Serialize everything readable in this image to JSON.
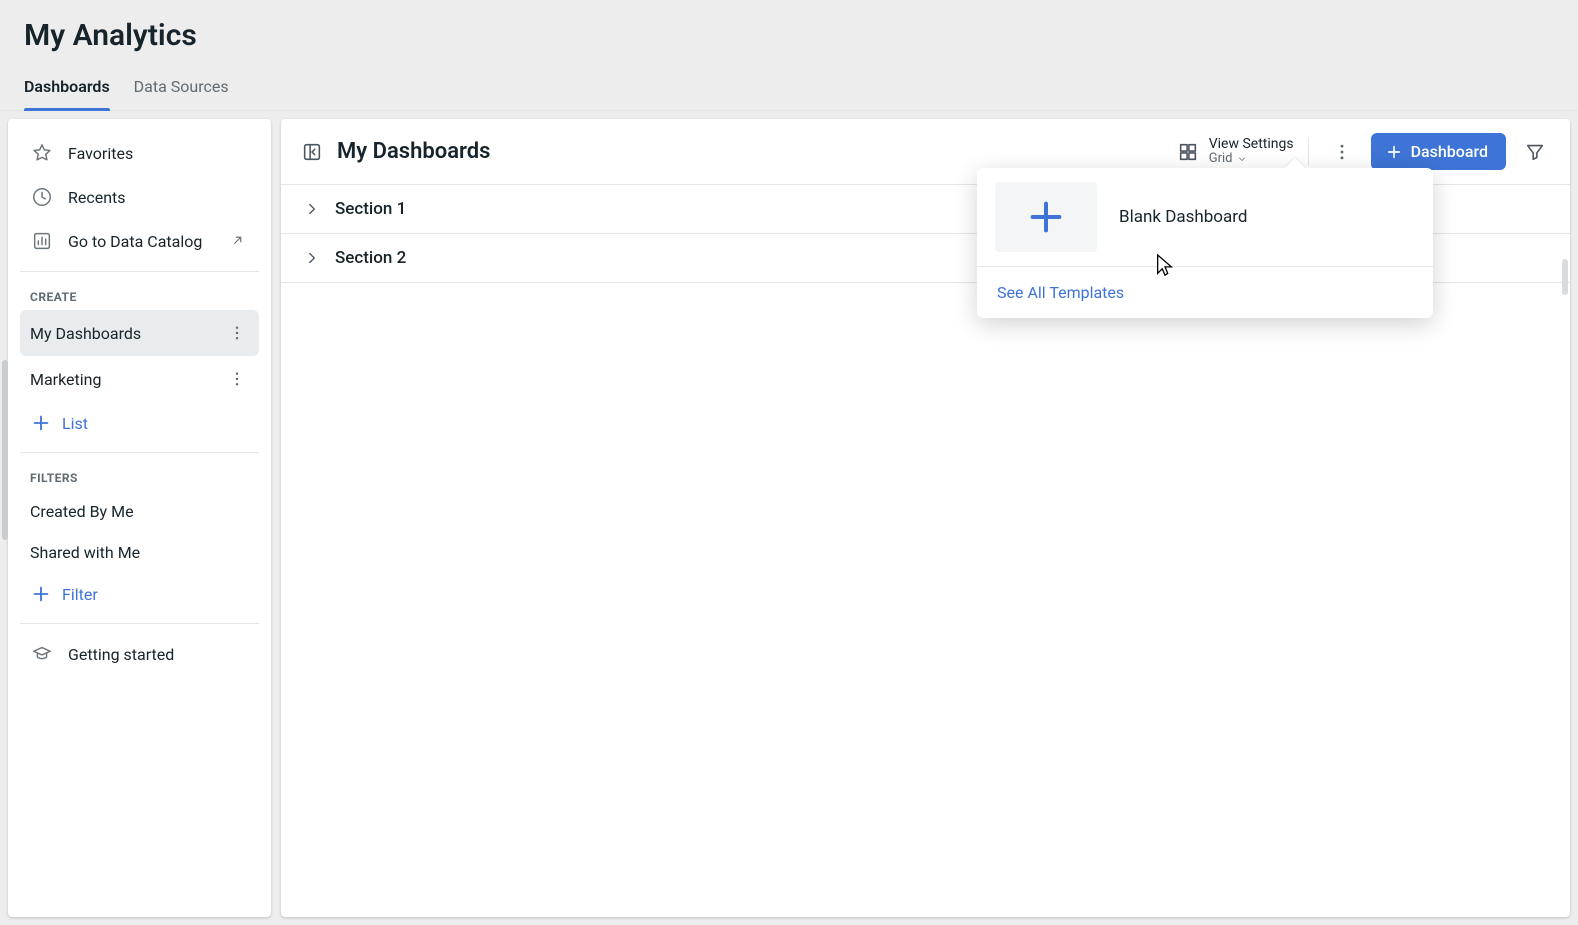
{
  "header": {
    "title": "My Analytics",
    "tabs": [
      {
        "label": "Dashboards",
        "active": true
      },
      {
        "label": "Data Sources",
        "active": false
      }
    ]
  },
  "sidebar": {
    "nav": {
      "favorites": "Favorites",
      "recents": "Recents",
      "data_catalog": "Go to Data Catalog"
    },
    "create_heading": "CREATE",
    "lists": [
      {
        "label": "My Dashboards",
        "selected": true
      },
      {
        "label": "Marketing",
        "selected": false
      }
    ],
    "add_list_label": "List",
    "filters_heading": "FILTERS",
    "filters": [
      {
        "label": "Created By Me"
      },
      {
        "label": "Shared with Me"
      }
    ],
    "add_filter_label": "Filter",
    "getting_started_label": "Getting started"
  },
  "main": {
    "title": "My Dashboards",
    "view_settings": {
      "label": "View Settings",
      "value": "Grid"
    },
    "new_dashboard_button": "Dashboard",
    "sections": [
      {
        "label": "Section 1"
      },
      {
        "label": "Section 2"
      }
    ]
  },
  "popover": {
    "blank_label": "Blank Dashboard",
    "see_all_label": "See All Templates"
  }
}
